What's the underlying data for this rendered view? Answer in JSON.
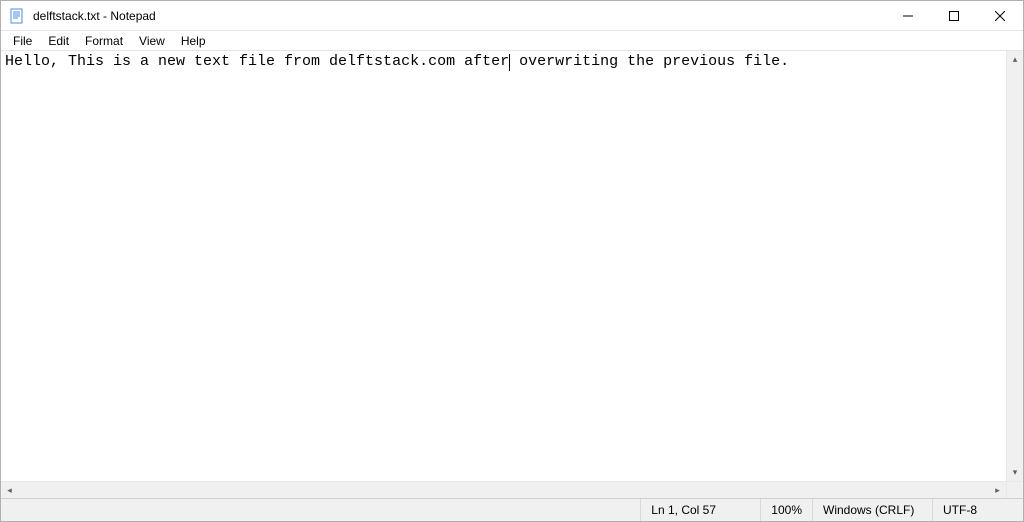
{
  "window": {
    "title": "delftstack.txt - Notepad"
  },
  "menu": {
    "file": "File",
    "edit": "Edit",
    "format": "Format",
    "view": "View",
    "help": "Help"
  },
  "editor": {
    "text_before_caret": "Hello, This is a new text file from delftstack.com after",
    "text_after_caret": " overwriting the previous file."
  },
  "status": {
    "position": "Ln 1, Col 57",
    "zoom": "100%",
    "line_ending": "Windows (CRLF)",
    "encoding": "UTF-8"
  }
}
